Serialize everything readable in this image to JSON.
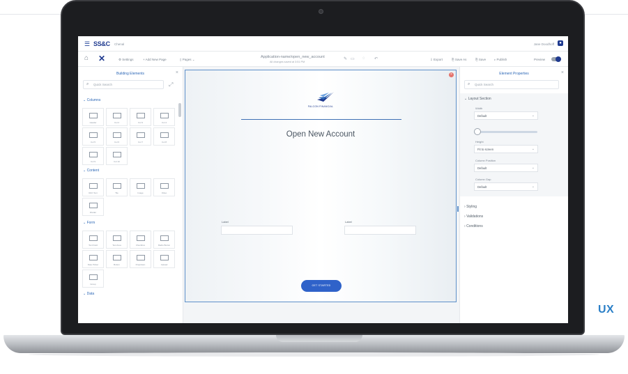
{
  "page": {
    "corner_text": "UX"
  },
  "app": {
    "logo_text": "SS&C",
    "subtitle": "Chenal",
    "user_name": "Jane Doodhoff"
  },
  "toolbar": {
    "settings": "Settings",
    "add_page": "Add New Page",
    "pages": "Pages",
    "doc_title": "Application-name/open_new_account",
    "saved_status": "All changes saved at 3:51 PM",
    "export": "Export",
    "save_as": "Save As",
    "save": "Save",
    "publish": "Publish",
    "preview": "Preview"
  },
  "left_panel": {
    "title": "Building Elements",
    "search_placeholder": "Quick Search",
    "sections": {
      "columns": "Columns",
      "content": "Content",
      "form": "Form",
      "data": "Data"
    },
    "column_tiles": [
      "Header",
      "Col 2",
      "Col 3",
      "Col 4",
      "Col 5",
      "Col 6",
      "Col 7",
      "Col 8",
      "Col 9",
      "Col 10"
    ],
    "content_tiles": [
      "Rich Text",
      "Tile",
      "Image",
      "Video",
      "Divider"
    ],
    "form_tiles": [
      "Text Field",
      "Text Area",
      "Checkbox",
      "Radio Button",
      "Date Picker",
      "Button",
      "Dropdown",
      "Upload",
      "Group"
    ]
  },
  "canvas": {
    "brand_name": "FALCON FINANCIAL",
    "form_title": "Open New Account",
    "label_left": "Label",
    "label_right": "Label",
    "cta": "GET STARTED"
  },
  "right_panel": {
    "title": "Element Properties",
    "search_placeholder": "Quick Search",
    "layout_section": "Layout Section",
    "width_label": "Width",
    "width_value": "Default",
    "height_label": "Height",
    "height_value": "Fit to screen",
    "column_position_label": "Column Position",
    "column_position_value": "Default",
    "column_gap_label": "Column Gap",
    "column_gap_value": "Default",
    "styling": "Styling",
    "validations": "Validations",
    "conditions": "Conditions"
  },
  "colors": {
    "brand": "#1f3a8f",
    "accent": "#2c67b6",
    "cta": "#2f62c9",
    "canvas_border": "#5d8fc9"
  }
}
